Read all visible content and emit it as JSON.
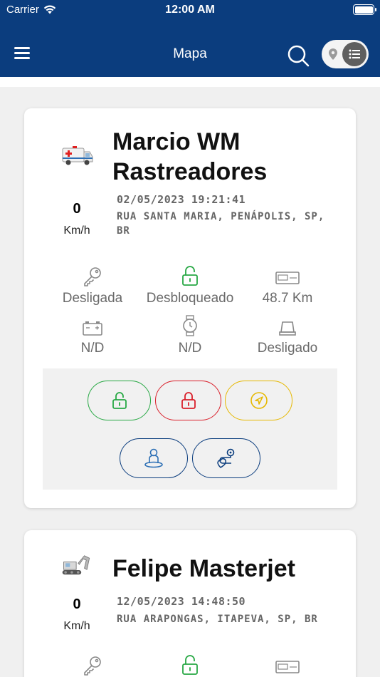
{
  "status_bar": {
    "carrier": "Carrier",
    "time": "12:00 AM"
  },
  "header": {
    "title": "Mapa"
  },
  "colors": {
    "brand": "#0b3d7e",
    "green": "#27a844",
    "red": "#d91f2a",
    "yellow": "#e6b800",
    "blue": "#0b3d7e"
  },
  "vehicles": [
    {
      "icon": "ambulance-icon",
      "name_line1": "Marcio WM",
      "name_line2": "Rastreadores",
      "speed": "0",
      "speed_unit": "Km/h",
      "datetime": "02/05/2023 19:21:41",
      "address": "RUA SANTA MARIA, PENÁPOLIS, SP, BR",
      "stats": {
        "ignition": "Desligada",
        "lock": "Desbloqueado",
        "odometer": "48.7 Km",
        "battery": "N/D",
        "hours": "N/D",
        "sensor": "Desligado"
      },
      "actions": [
        "unlock-button",
        "lock-button",
        "navigate-button",
        "driver-button",
        "route-button"
      ]
    },
    {
      "icon": "excavator-icon",
      "name_line1": "Felipe Masterjet",
      "speed": "0",
      "speed_unit": "Km/h",
      "datetime": "12/05/2023 14:48:50",
      "address": "RUA ARAPONGAS, ITAPEVA, SP, BR"
    }
  ]
}
